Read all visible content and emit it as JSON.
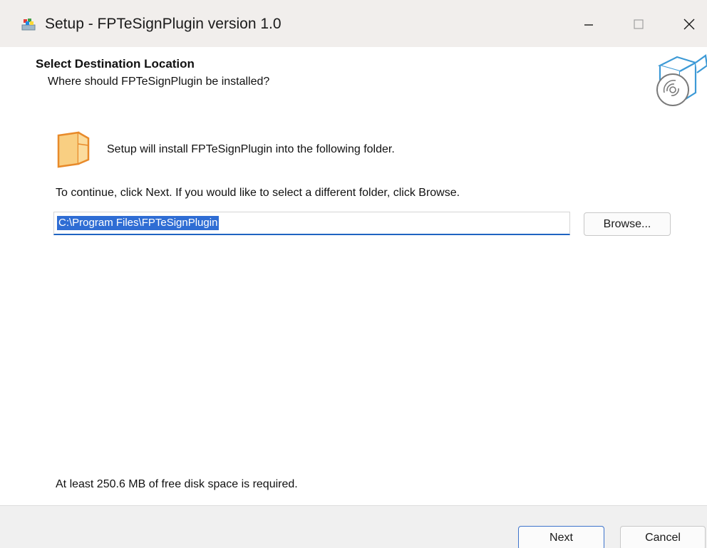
{
  "window": {
    "title": "Setup - FPTeSignPlugin version 1.0",
    "app_icon": "setup-installer-icon",
    "controls": {
      "minimize_icon": "minimize-icon",
      "maximize_icon": "maximize-icon",
      "close_icon": "close-icon"
    }
  },
  "header": {
    "title": "Select Destination Location",
    "subtitle": "Where should FPTeSignPlugin be installed?",
    "graphic_icon": "box-disc-icon"
  },
  "body": {
    "folder_icon": "folder-icon",
    "install_info": "Setup will install FPTeSignPlugin into the following folder.",
    "continue_info": "To continue, click Next. If you would like to select a different folder, click Browse.",
    "path_field": {
      "value": "C:\\Program Files\\FPTeSignPlugin",
      "selected": true
    },
    "browse_label": "Browse...",
    "disk_space_text": "At least 250.6 MB of free disk space is required."
  },
  "footer": {
    "next_label": "Next",
    "cancel_label": "Cancel"
  },
  "colors": {
    "titlebar_bg": "#f1eeec",
    "selection": "#2f6dd4",
    "focus_border": "#1f64c2",
    "folder_fill": "#f9cf82",
    "folder_stroke": "#e88a2a",
    "graphic_stroke": "#3d9ad6"
  }
}
